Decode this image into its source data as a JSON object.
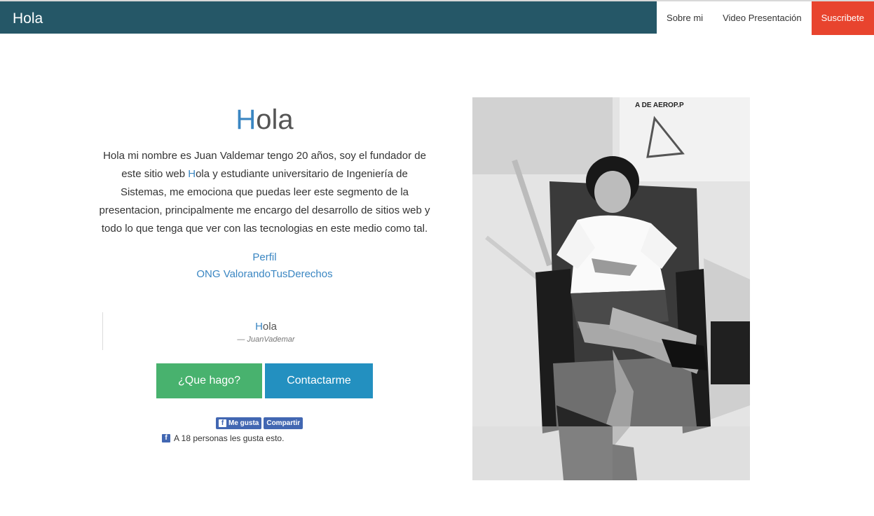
{
  "navbar": {
    "brand": "Hola",
    "links": [
      "Sobre mi",
      "Video Presentación"
    ],
    "subscribe": "Suscribete",
    "colors": {
      "bar": "#255767",
      "subscribe": "#e8442e"
    }
  },
  "intro": {
    "title_first": "H",
    "title_rest": "ola",
    "bio_part1": "Hola mi nombre es Juan Valdemar tengo 20 años, soy el fundador de este sitio web ",
    "bio_h": "H",
    "bio_part2": "ola y estudiante universitario de Ingeniería de Sistemas, me emociona que puedas leer este segmento de la presentacion, principalmente me encargo del desarrollo de sitios web y todo lo que tenga que ver con las tecnologias en este medio como tal.",
    "links": [
      "Perfil",
      "ONG ValorandoTusDerechos"
    ]
  },
  "quote": {
    "text_first": "H",
    "text_rest": "ola",
    "author": "— JuanVademar"
  },
  "buttons": {
    "what_i_do": "¿Que hago?",
    "contact": "Contactarme",
    "colors": {
      "green": "#48b26e",
      "blue": "#2390c0"
    }
  },
  "facebook": {
    "like": "Me gusta",
    "share": "Compartir",
    "count_text": "A 18 personas les gusta esto.",
    "logo_glyph": "f"
  },
  "photo": {
    "sign_text": "A DE AEROP.P"
  }
}
